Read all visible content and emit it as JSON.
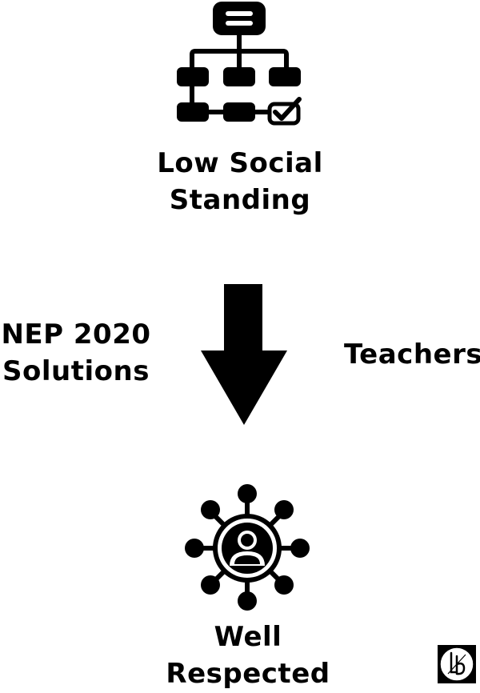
{
  "top_node": {
    "lines": [
      "Low Social",
      "Standing"
    ],
    "icon": "hierarchy-checklist-icon"
  },
  "bottom_node": {
    "lines": [
      "Well",
      "Respected"
    ],
    "icon": "person-network-icon"
  },
  "left_label": {
    "lines": [
      "NEP 2020",
      "Solutions"
    ]
  },
  "right_label": {
    "text": "Teachers"
  },
  "connector": {
    "icon": "down-arrow-icon"
  },
  "logo": {
    "icon": "logo-mark-icon",
    "text": "lb"
  },
  "colors": {
    "ink": "#000000",
    "background": "#ffffff"
  }
}
